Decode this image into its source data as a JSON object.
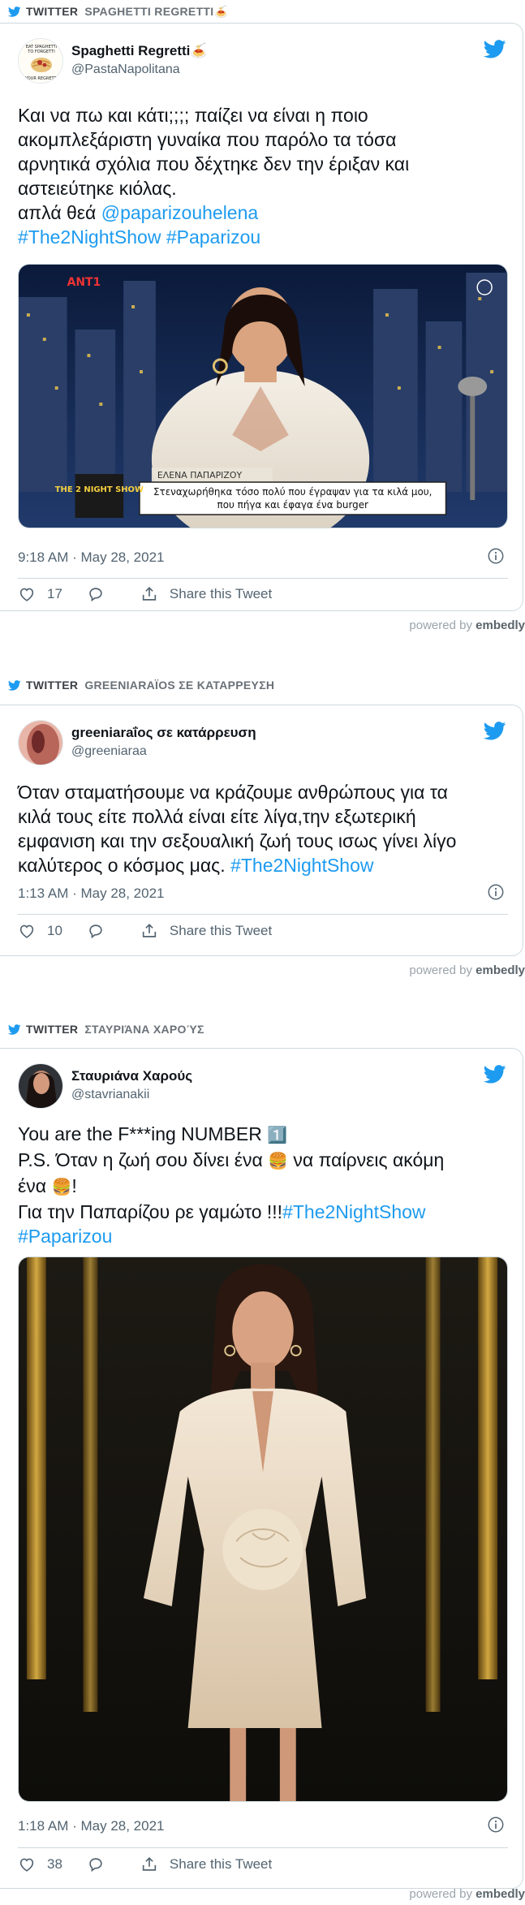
{
  "colors": {
    "link": "#1d9bf0",
    "twitter_blue": "#1d9bf0",
    "border": "#cfd9de",
    "muted": "#536471"
  },
  "powered_by": {
    "prefix": "powered by",
    "brand": "embedly"
  },
  "embeds": [
    {
      "label_source": "TWITTER",
      "label_title": "SPAGHETTI REGRETTI🍝",
      "author_name": "Spaghetti Regretti🍝",
      "author_handle": "@PastaNapolitana",
      "avatar_text": "EAT SPAGHETTI TO FORGETTI YOUR REGRETTI",
      "text_lines": [
        "Και να πω και κάτι;;;; παίζει να είναι η ποιο",
        "ακομπλεξάριστη γυναίκα που παρόλο τα τόσα",
        "αρνητικά σχόλια που δέχτηκε δεν την έριξαν και",
        "αστειεύτηκε κιόλας."
      ],
      "text_mention_prefix": "απλά θεά ",
      "text_mention": "@paparizouhelena",
      "text_hashtags": "#The2NightShow #Paparizou",
      "media_caption_name": "ΕΛΕΝΑ ΠΑΠΑΡΙΖΟΥ",
      "media_caption_line1": "Στεναχωρήθηκα τόσο πολύ που έγραψαν για τα κιλά μου,",
      "media_caption_line2": "που πήγα και έφαγα ένα burger",
      "media_show_logo": "THE 2 NIGHT SHOW",
      "media_channel": "ANT1",
      "timestamp": "9:18 AM · May 28, 2021",
      "likes": "17",
      "share_label": "Share this Tweet"
    },
    {
      "label_source": "TWITTER",
      "label_title": "GREENIARAΪOS ΣΕ ΚΑΤΑΡΡΕΥΣΗ",
      "author_name": "greeniaraΐος σε κατάρρευση",
      "author_handle": "@greeniaraa",
      "text_lines": [
        "Όταν σταματήσουμε να κράζουμε ανθρώπους για τα",
        "κιλά τους είτε πολλά είναι είτε λίγα,την εξωτερική",
        "εμφανιση και την σεξουαλική ζωή τους ισως γίνει λίγο"
      ],
      "text_last_prefix": "καλύτερος ο κόσμος μας. ",
      "text_hashtags": "#The2NightShow",
      "timestamp": "1:13 AM · May 28, 2021",
      "likes": "10",
      "share_label": "Share this Tweet"
    },
    {
      "label_source": "TWITTER",
      "label_title": "ΣΤΑΥΡΙΆΝΑ ΧΑΡΟΎΣ",
      "author_name": "Σταυριάνα Χαρούς",
      "author_handle": "@stavrianakii",
      "line1": "You are the F***ing NUMBER ",
      "line1_emoji": "1️⃣",
      "line2_a": "P.S. Όταν η ζωή σου δίνει ένα ",
      "line2_emoji": "🍔",
      "line2_b": " να παίρνεις ακόμη",
      "line3_a": "ένα ",
      "line3_emoji": "🍔",
      "line3_b": "!",
      "line4_a": "Για την Παπαρίζου ρε γαμώτο !!!",
      "line4_hashtag": "#The2NightShow",
      "line5_hashtag": "#Paparizou",
      "timestamp": "1:18 AM · May 28, 2021",
      "likes": "38",
      "share_label": "Share this Tweet"
    }
  ]
}
